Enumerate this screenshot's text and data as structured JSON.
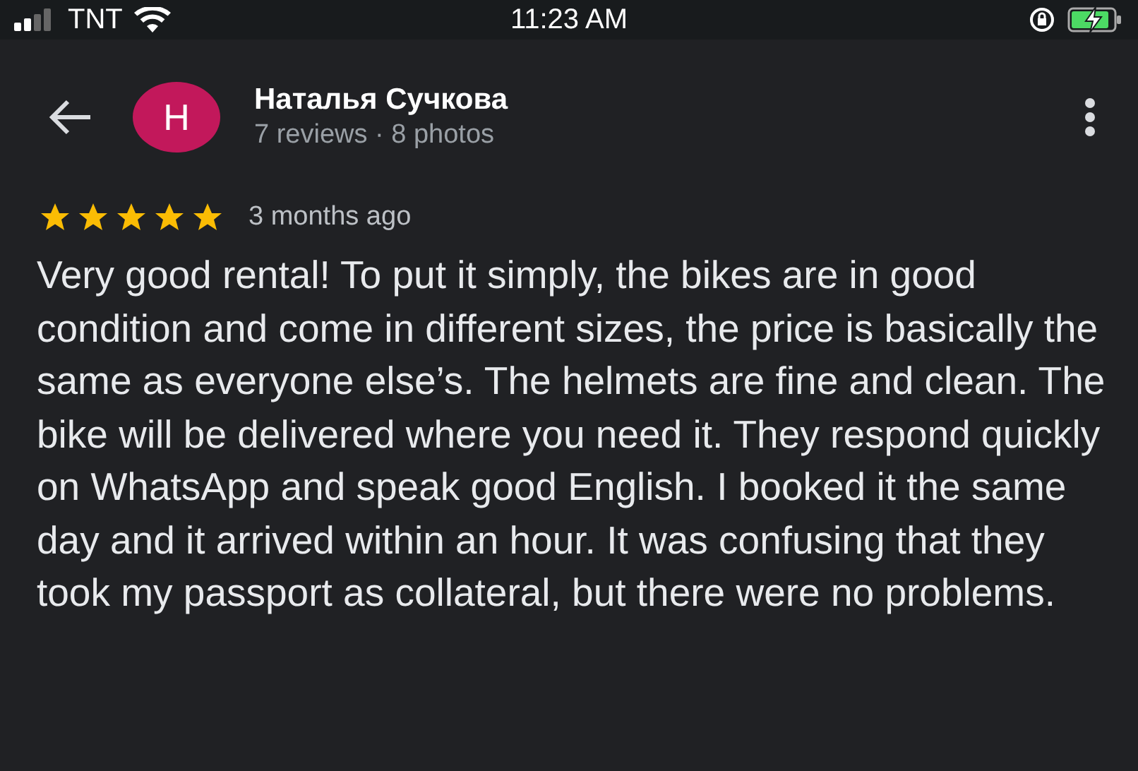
{
  "status_bar": {
    "carrier": "TNT",
    "time": "11:23 AM"
  },
  "header": {
    "avatar_letter": "H",
    "name": "Наталья Сучкова",
    "meta": "7 reviews · 8 photos"
  },
  "review": {
    "stars": 5,
    "age": "3 months ago",
    "text": "Very good rental! To put it simply, the bikes are in good condition and come in different sizes, the price is basically the same as everyone else’s. The helmets are fine and clean. The bike will be delivered where you need it. They respond quickly on WhatsApp and speak good English. I booked it the same day and it arrived within an hour. It was confusing that they took my passport as collateral, but there were no problems."
  }
}
